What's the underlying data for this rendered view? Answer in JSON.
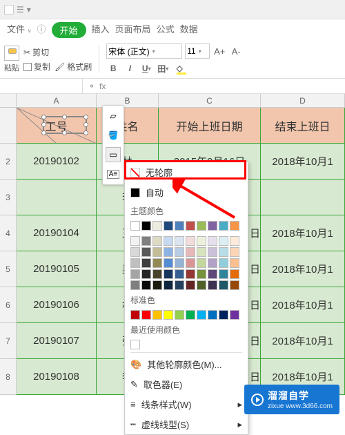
{
  "titlebar": {
    "icon": "app-icon"
  },
  "menu": {
    "file": "文件",
    "start": "开始",
    "insert": "插入",
    "layout": "页面布局",
    "formula": "公式",
    "data": "数据"
  },
  "toolbar": {
    "paste": "粘贴",
    "cut": "剪切",
    "copy": "复制",
    "formatpaint": "格式刷",
    "font_name": "宋体 (正文)",
    "font_size": "11",
    "inc": "A+",
    "dec": "A-",
    "bold": "B",
    "italic": "I",
    "underline": "U",
    "border": "田"
  },
  "formula_bar": {
    "fx": "fx"
  },
  "columns": [
    "A",
    "B",
    "C",
    "D"
  ],
  "header_row": {
    "a": "工号",
    "b": "姓名",
    "c": "开始上班日期",
    "d": "结束上班日"
  },
  "rows": [
    {
      "n": "2",
      "a": "20190102",
      "b": "林",
      "c": "2015年9月16日",
      "d": "2018年10月1"
    },
    {
      "n": "3",
      "a": "",
      "b": "李",
      "c": "",
      "d": ""
    },
    {
      "n": "4",
      "a": "20190104",
      "b": "王",
      "c": "",
      "d": "2018年10月1"
    },
    {
      "n": "5",
      "a": "20190105",
      "b": "吴",
      "c": "",
      "d": "2018年10月1"
    },
    {
      "n": "6",
      "a": "20190106",
      "b": "林",
      "c": "",
      "d": "2018年10月1"
    },
    {
      "n": "7",
      "a": "20190107",
      "b": "张",
      "c": "",
      "d": "2018年10月1"
    },
    {
      "n": "8",
      "a": "20190108",
      "b": "李",
      "c": "",
      "d": "2018年10月1"
    }
  ],
  "partial_dates": {
    "suffix": "日"
  },
  "ctx": {
    "nooutline": "无轮廓",
    "auto": "自动",
    "theme": "主题颜色",
    "standard": "标准色",
    "recent": "最近使用颜色",
    "more": "其他轮廓颜色(M)...",
    "eyedropper": "取色器(E)",
    "linestyle": "线条样式(W)",
    "dashstyle": "虚线线型(S)"
  },
  "theme_colors_rows": [
    [
      "#ffffff",
      "#000000",
      "#eeece1",
      "#1f497d",
      "#4f81bd",
      "#c0504d",
      "#9bbb59",
      "#8064a2",
      "#4bacc6",
      "#f79646"
    ],
    [
      "#f2f2f2",
      "#7f7f7f",
      "#ddd9c3",
      "#c6d9f0",
      "#dbe5f1",
      "#f2dcdb",
      "#ebf1dd",
      "#e5e0ec",
      "#dbeef3",
      "#fdeada"
    ],
    [
      "#d8d8d8",
      "#595959",
      "#c4bd97",
      "#8db3e2",
      "#b8cce4",
      "#e5b9b7",
      "#d7e3bc",
      "#ccc1d9",
      "#b7dde8",
      "#fbd5b5"
    ],
    [
      "#bfbfbf",
      "#3f3f3f",
      "#938953",
      "#548dd4",
      "#95b3d7",
      "#d99694",
      "#c3d69b",
      "#b2a2c7",
      "#92cddc",
      "#fac08f"
    ],
    [
      "#a5a5a5",
      "#262626",
      "#494429",
      "#17365d",
      "#366092",
      "#953734",
      "#76923c",
      "#5f497a",
      "#31859b",
      "#e36c09"
    ],
    [
      "#7f7f7f",
      "#0c0c0c",
      "#1d1b10",
      "#0f243e",
      "#244061",
      "#632423",
      "#4f6128",
      "#3f3151",
      "#205867",
      "#974806"
    ]
  ],
  "standard_colors": [
    "#c00000",
    "#ff0000",
    "#ffc000",
    "#ffff00",
    "#92d050",
    "#00b050",
    "#00b0f0",
    "#0070c0",
    "#002060",
    "#7030a0"
  ],
  "recent_colors": [
    "#ffffff"
  ],
  "watermark": {
    "brand": "溜溜自学",
    "domain": "zixue",
    "domain2": "www.3d66.com"
  }
}
